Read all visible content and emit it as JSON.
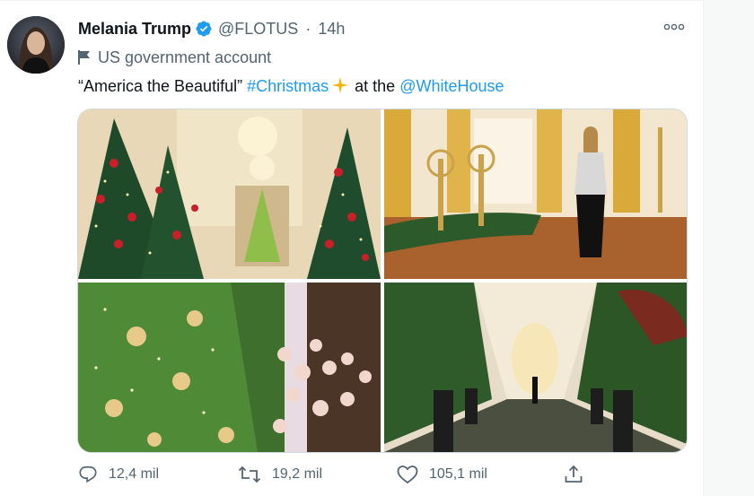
{
  "tweet": {
    "author_name": "Melania Trump",
    "handle": "@FLOTUS",
    "separator": "·",
    "time": "14h",
    "account_label": "US government account",
    "text_quote": "“America the Beautiful”",
    "hashtag": "#Christmas",
    "text_mid": "at the",
    "mention": "@WhiteHouse"
  },
  "photos": [
    {
      "subject": "east-room-christmas-trees"
    },
    {
      "subject": "melania-with-candelabras-and-garland"
    },
    {
      "subject": "flower-garland-and-golden-ornaments"
    },
    {
      "subject": "colonnade-hallway-with-potted-trees"
    }
  ],
  "actions": {
    "reply_count": "12,4 mil",
    "retweet_count": "19,2 mil",
    "like_count": "105,1 mil"
  },
  "icons": [
    "verified-badge-icon",
    "flag-icon",
    "sparkle-emoji",
    "more-icon",
    "reply-icon",
    "retweet-icon",
    "like-icon",
    "share-icon"
  ],
  "colors": {
    "accent": "#1d9bf0",
    "secondary_text": "#536471",
    "primary_text": "#0f1419"
  }
}
